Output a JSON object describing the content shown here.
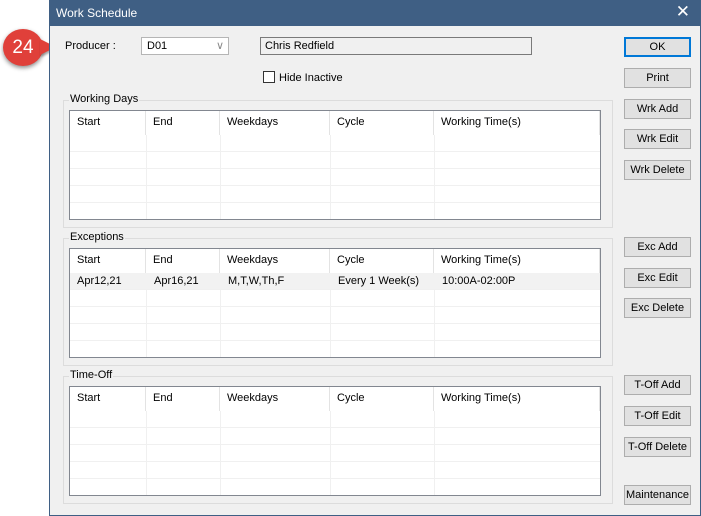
{
  "window": {
    "title": "Work Schedule",
    "close_glyph": "✕"
  },
  "annotation": {
    "number": "24"
  },
  "producer": {
    "label": "Producer :",
    "selected": "D01",
    "name": "Chris Redfield",
    "hide_inactive_label": "Hide Inactive",
    "hide_inactive_checked": false
  },
  "columns": [
    "Start",
    "End",
    "Weekdays",
    "Cycle",
    "Working Time(s)"
  ],
  "working_days": {
    "title": "Working Days",
    "rows": []
  },
  "exceptions": {
    "title": "Exceptions",
    "rows": [
      [
        "Apr12,21",
        "Apr16,21",
        "M,T,W,Th,F",
        "Every 1 Week(s)",
        "10:00A-02:00P"
      ]
    ]
  },
  "time_off": {
    "title": "Time-Off",
    "rows": []
  },
  "buttons": {
    "ok": "OK",
    "print": "Print",
    "wrk_add": "Wrk Add",
    "wrk_edit": "Wrk Edit",
    "wrk_delete": "Wrk Delete",
    "exc_add": "Exc Add",
    "exc_edit": "Exc Edit",
    "exc_delete": "Exc Delete",
    "toff_add": "T-Off Add",
    "toff_edit": "T-Off Edit",
    "toff_delete": "T-Off Delete",
    "maintenance": "Maintenance"
  },
  "colors": {
    "titlebar": "#3f5f84",
    "badge": "#e0403a",
    "default_button_border": "#0078d7"
  }
}
